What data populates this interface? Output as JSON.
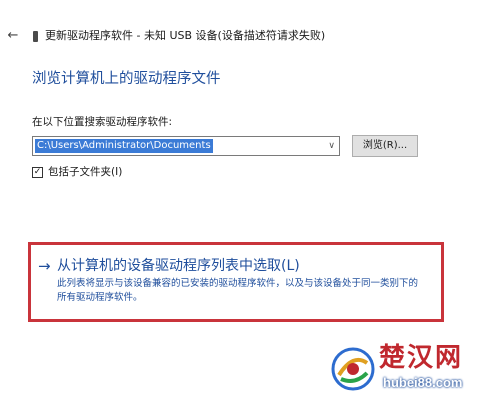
{
  "window": {
    "back_icon": "arrow-left-icon",
    "title": "更新驱动程序软件 - 未知 USB 设备(设备描述符请求失败)"
  },
  "heading": "浏览计算机上的驱动程序文件",
  "path": {
    "label": "在以下位置搜索驱动程序软件:",
    "value": "C:\\Users\\Administrator\\Documents",
    "browse_label": "浏览(R)..."
  },
  "include_subfolders": {
    "checked": true,
    "label": "包括子文件夹(I)"
  },
  "pick": {
    "arrow": "→",
    "title": "从计算机的设备驱动程序列表中选取(L)",
    "desc_line1": "此列表将显示与该设备兼容的已安装的驱动程序软件，以及与该设备处于同一类别下的",
    "desc_line2": "所有驱动程序软件。"
  },
  "watermark": {
    "brand": "楚汉网",
    "url": "hubei88.com"
  },
  "colors": {
    "accent": "#1f4e9c",
    "highlight": "#c9343b",
    "selection": "#3b7bd6"
  }
}
